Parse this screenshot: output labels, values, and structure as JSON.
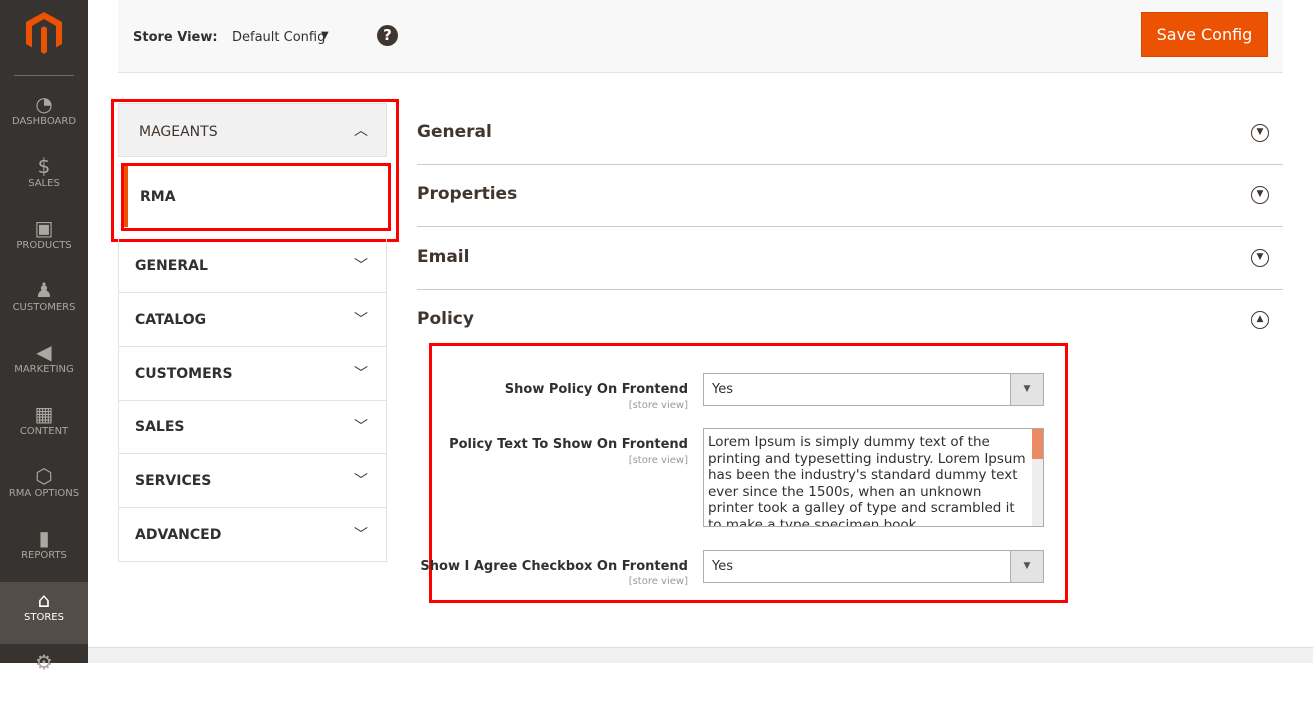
{
  "nav": {
    "items": [
      {
        "label": "DASHBOARD",
        "icon": "dashboard-icon",
        "glyph": "◔"
      },
      {
        "label": "SALES",
        "icon": "dollar-icon",
        "glyph": "$"
      },
      {
        "label": "PRODUCTS",
        "icon": "box-icon",
        "glyph": "▣"
      },
      {
        "label": "CUSTOMERS",
        "icon": "person-icon",
        "glyph": "♟"
      },
      {
        "label": "MARKETING",
        "icon": "megaphone-icon",
        "glyph": "◀"
      },
      {
        "label": "CONTENT",
        "icon": "layout-icon",
        "glyph": "▦"
      },
      {
        "label": "RMA OPTIONS",
        "icon": "hexagon-icon",
        "glyph": "⬡"
      },
      {
        "label": "REPORTS",
        "icon": "bar-chart-icon",
        "glyph": "▮"
      },
      {
        "label": "STORES",
        "icon": "store-icon",
        "glyph": "⌂"
      },
      {
        "label": "",
        "icon": "gear-icon",
        "glyph": "⚙"
      }
    ]
  },
  "toolbar": {
    "store_view_label": "Store View:",
    "store_view_value": "Default Config",
    "save_label": "Save Config"
  },
  "tabs": {
    "header": "MAGEANTS",
    "active_item": "RMA",
    "groups": [
      "GENERAL",
      "CATALOG",
      "CUSTOMERS",
      "SALES",
      "SERVICES",
      "ADVANCED"
    ]
  },
  "sections": [
    "General",
    "Properties",
    "Email",
    "Policy"
  ],
  "policy": {
    "show_policy_label": "Show Policy On Frontend",
    "show_policy_value": "Yes",
    "policy_text_label": "Policy Text To Show On Frontend",
    "policy_text_value": "Lorem Ipsum is simply dummy text of the printing and typesetting industry. Lorem Ipsum has been the industry's standard dummy text ever since the 1500s, when an unknown printer took a galley of type and scrambled it to make a type specimen book.",
    "agree_label": "Show I Agree Checkbox On Frontend",
    "agree_value": "Yes",
    "scope": "[store view]"
  },
  "colors": {
    "accent": "#eb5202",
    "highlight": "#ff0000",
    "nav_bg": "#373330"
  }
}
